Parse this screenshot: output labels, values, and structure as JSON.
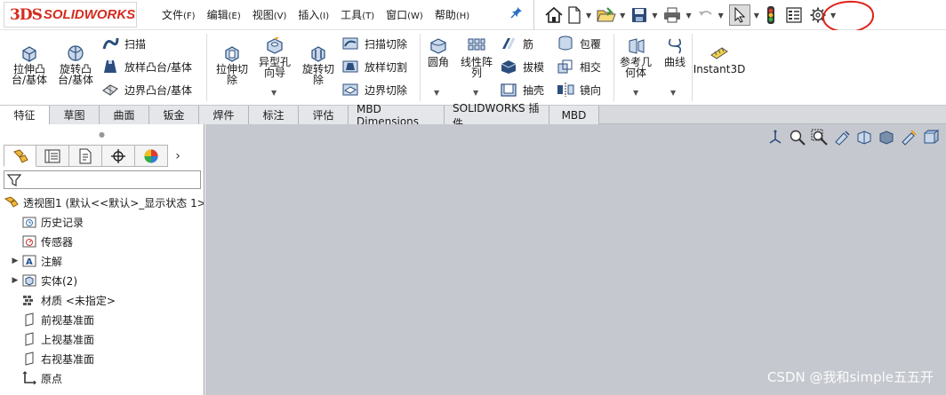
{
  "app": {
    "logo_mark": "3DS",
    "logo_text": "SOLIDWORKS"
  },
  "menu": [
    {
      "label": "文件",
      "accel": "(F)"
    },
    {
      "label": "编辑",
      "accel": "(E)"
    },
    {
      "label": "视图",
      "accel": "(V)"
    },
    {
      "label": "插入",
      "accel": "(I)"
    },
    {
      "label": "工具",
      "accel": "(T)"
    },
    {
      "label": "窗口",
      "accel": "(W)"
    },
    {
      "label": "帮助",
      "accel": "(H)"
    }
  ],
  "quick_access": [
    "home-icon",
    "new-document-icon",
    "open-folder-icon",
    "save-icon",
    "print-icon",
    "undo-icon",
    "select-cursor-icon",
    "rebuild-traffic-light-icon",
    "file-properties-icon",
    "options-gear-icon"
  ],
  "annotation_color": "#e0201a",
  "ribbon": {
    "extrude_boss": "拉伸凸\n台/基体",
    "revolve_boss": "旋转凸\n台/基体",
    "sweep": "扫描",
    "loft_boss": "放样凸台/基体",
    "boundary_boss": "边界凸台/基体",
    "extrude_cut": "拉伸切\n除",
    "hole_wizard": "异型孔\n向导",
    "revolve_cut": "旋转切\n除",
    "sweep_cut": "扫描切除",
    "loft_cut": "放样切割",
    "boundary_cut": "边界切除",
    "fillet": "圆角",
    "linear_pattern": "线性阵\n列",
    "rib": "筋",
    "draft": "拔模",
    "shell": "抽壳",
    "wrap": "包覆",
    "intersect": "相交",
    "mirror": "镜向",
    "ref_geometry": "参考几\n何体",
    "curves": "曲线",
    "instant3d": "Instant3D"
  },
  "tabs": [
    "特征",
    "草图",
    "曲面",
    "钣金",
    "焊件",
    "标注",
    "评估",
    "MBD Dimensions",
    "SOLIDWORKS 插件",
    "MBD"
  ],
  "feature_tree": {
    "root": "透视图1  (默认<<默认>_显示状态 1>",
    "items": [
      {
        "label": "历史记录",
        "icon": "history-folder-icon",
        "expandable": false
      },
      {
        "label": "传感器",
        "icon": "sensor-icon",
        "expandable": false
      },
      {
        "label": "注解",
        "icon": "annotation-icon",
        "expandable": true
      },
      {
        "label": "实体(2)",
        "icon": "solid-bodies-icon",
        "expandable": true
      },
      {
        "label": "材质 <未指定>",
        "icon": "material-icon",
        "expandable": false
      },
      {
        "label": "前视基准面",
        "icon": "plane-icon",
        "expandable": false
      },
      {
        "label": "上视基准面",
        "icon": "plane-icon",
        "expandable": false
      },
      {
        "label": "右视基准面",
        "icon": "plane-icon",
        "expandable": false
      },
      {
        "label": "原点",
        "icon": "origin-icon",
        "expandable": false
      }
    ]
  },
  "watermark": "CSDN @我和simple五五开"
}
